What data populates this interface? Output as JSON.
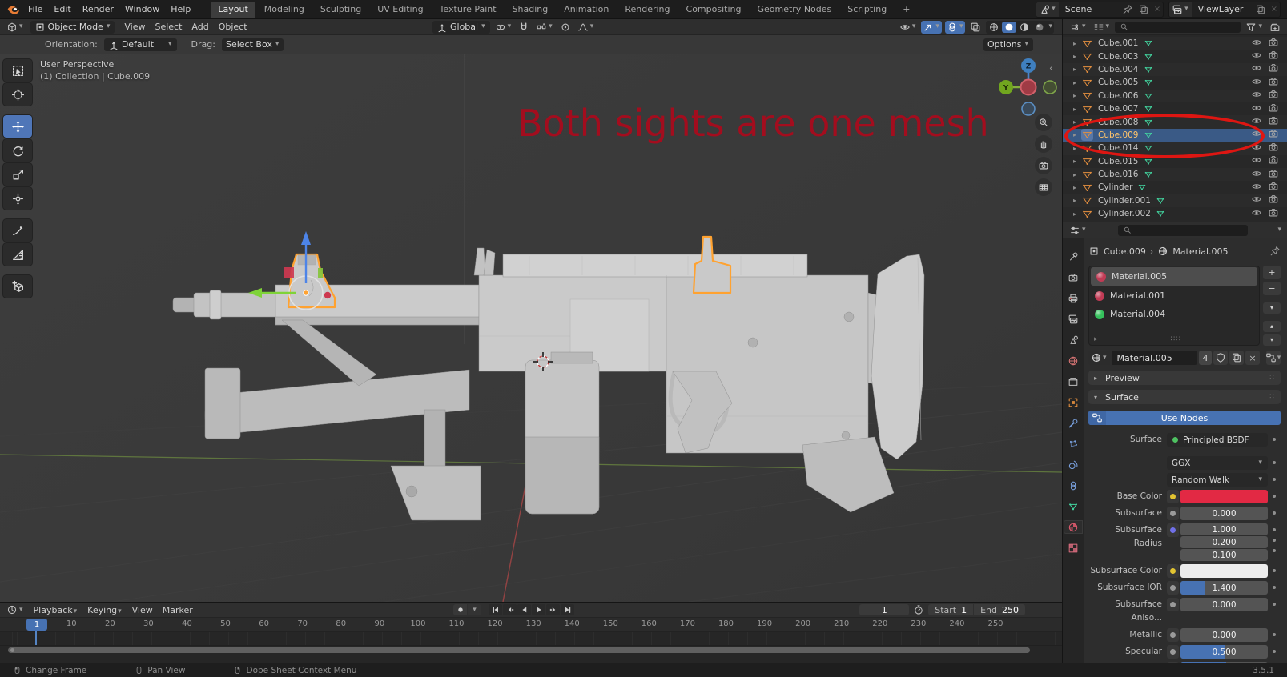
{
  "colors": {
    "accent_blue": "#4772b3",
    "selection_orange": "#ffa230",
    "annotation_red": "#a30d1e",
    "callout_red": "#de1612",
    "base_color_swatch": "#e22944"
  },
  "topbar": {
    "logo_icon": "blender-logo",
    "menus": [
      "File",
      "Edit",
      "Render",
      "Window",
      "Help"
    ],
    "workspaces": [
      "Layout",
      "Modeling",
      "Sculpting",
      "UV Editing",
      "Texture Paint",
      "Shading",
      "Animation",
      "Rendering",
      "Compositing",
      "Geometry Nodes",
      "Scripting"
    ],
    "active_workspace": "Layout",
    "add_workspace_label": "+",
    "scene_name": "Scene",
    "view_layer_name": "ViewLayer"
  },
  "viewport": {
    "header": {
      "editor_icon": "editor-3d",
      "mode_icon": "object-mode",
      "mode": "Object Mode",
      "menus": [
        "View",
        "Select",
        "Add",
        "Object"
      ],
      "orientation_value": "Global",
      "center_icons": [
        "transform-orientation",
        "pivot-point",
        "snap-magnet",
        "snap-target",
        "proportional-editing",
        "proportional-falloff"
      ],
      "right_icons": [
        "visibility",
        "gizmos",
        "overlays",
        "x-ray"
      ],
      "shading_icons": [
        "shading-wireframe",
        "shading-solid",
        "shading-material",
        "shading-rendered"
      ],
      "active_shading": "shading-solid"
    },
    "tool_settings": {
      "orientation_label": "Orientation:",
      "orientation_value": "Default",
      "drag_label": "Drag:",
      "drag_value": "Select Box",
      "options_label": "Options"
    },
    "overlay": {
      "line1": "User Perspective",
      "line2": "(1) Collection | Cube.009"
    },
    "annotation_text": "Both sights are one mesh",
    "tools": [
      "select-box",
      "cursor",
      "move",
      "rotate",
      "scale",
      "transform",
      "annotate",
      "measure",
      "add-cube"
    ],
    "active_tool": "move",
    "nav_gizmo_axes": [
      "Z",
      "Y"
    ],
    "nav_widgets": [
      "zoom",
      "pan-hand",
      "camera-view",
      "grid-ortho"
    ]
  },
  "outliner": {
    "header_icons": [
      "editor-outliner",
      "display-mode",
      "search",
      "filter",
      "new-collection"
    ],
    "items": [
      {
        "name": "Cube.001"
      },
      {
        "name": "Cube.003"
      },
      {
        "name": "Cube.004"
      },
      {
        "name": "Cube.005"
      },
      {
        "name": "Cube.006"
      },
      {
        "name": "Cube.007"
      },
      {
        "name": "Cube.008"
      },
      {
        "name": "Cube.009",
        "selected": true,
        "circled": true
      },
      {
        "name": "Cube.014"
      },
      {
        "name": "Cube.015"
      },
      {
        "name": "Cube.016"
      },
      {
        "name": "Cylinder"
      },
      {
        "name": "Cylinder.001"
      },
      {
        "name": "Cylinder.002"
      }
    ]
  },
  "properties": {
    "header_icons": [
      "editor-properties",
      "search"
    ],
    "tab_icons": [
      "tool",
      "render",
      "output",
      "view-layer",
      "scene",
      "world",
      "collection",
      "object",
      "modifiers",
      "particles",
      "physics",
      "constraints",
      "object-data",
      "material",
      "texture"
    ],
    "active_tab": "material",
    "breadcrumb": {
      "object": "Cube.009",
      "material": "Material.005"
    },
    "slots": [
      {
        "name": "Material.005",
        "color": "#c13b55",
        "selected": true
      },
      {
        "name": "Material.001",
        "color": "#c13b55",
        "selected": false
      },
      {
        "name": "Material.004",
        "color": "#35c15c",
        "selected": false
      }
    ],
    "datablock": {
      "name": "Material.005",
      "users": "4"
    },
    "panels": {
      "preview": "Preview",
      "surface": "Surface"
    },
    "use_nodes_label": "Use Nodes",
    "fields": [
      {
        "label": "Surface",
        "widget": "chip",
        "value": "Principled BSDF",
        "dot": "#4ec161"
      },
      {
        "label": "",
        "widget": "select",
        "value": "GGX",
        "gap_before": true
      },
      {
        "label": "",
        "widget": "select",
        "value": "Random Walk"
      },
      {
        "label": "Base Color",
        "widget": "color",
        "socket": "#e2c431",
        "value": "#e22944"
      },
      {
        "label": "Subsurface",
        "widget": "value",
        "socket": "#9a9a9a",
        "value": "0.000",
        "fill": 0
      },
      {
        "label": "Subsurface Radius",
        "widget": "vector",
        "socket": "#7070e8",
        "values": [
          "1.000",
          "0.200",
          "0.100"
        ]
      },
      {
        "label": "Subsurface Color",
        "widget": "color",
        "socket": "#e2c431",
        "value": "#ececec"
      },
      {
        "label": "Subsurface IOR",
        "widget": "value",
        "socket": "#9a9a9a",
        "value": "1.400",
        "fill": 0.28
      },
      {
        "label": "Subsurface Aniso...",
        "widget": "value",
        "socket": "#9a9a9a",
        "value": "0.000",
        "fill": 0
      },
      {
        "label": "Metallic",
        "widget": "value",
        "socket": "#9a9a9a",
        "value": "0.000",
        "fill": 0
      },
      {
        "label": "Specular",
        "widget": "value",
        "socket": "#9a9a9a",
        "value": "0.500",
        "fill": 0.5
      },
      {
        "label": "",
        "widget": "value",
        "socket": "#9a9a9a",
        "value": "",
        "fill": 0.52,
        "partial": true
      }
    ]
  },
  "timeline": {
    "editor_icon": "editor-timeline",
    "menus": [
      {
        "label": "Playback",
        "caret": true
      },
      {
        "label": "Keying",
        "caret": true
      },
      {
        "label": "View",
        "caret": false
      },
      {
        "label": "Marker",
        "caret": false
      }
    ],
    "transport": [
      "record",
      "jump-to-start",
      "previous-keyframe",
      "play-reverse",
      "play",
      "next-keyframe",
      "jump-to-end"
    ],
    "current_frame": "1",
    "start_label": "Start",
    "start_value": "1",
    "end_label": "End",
    "end_value": "250",
    "frame_start": 1,
    "frame_end": 250,
    "tick_frames": [
      10,
      20,
      30,
      40,
      50,
      60,
      70,
      80,
      90,
      100,
      110,
      120,
      130,
      140,
      150,
      160,
      170,
      180,
      190,
      200,
      210,
      220,
      230,
      240,
      250
    ]
  },
  "statusbar": {
    "hints": [
      {
        "icon": "mouse-left",
        "label": "Change Frame"
      },
      {
        "icon": "mouse-middle",
        "label": "Pan View"
      },
      {
        "icon": "mouse-right",
        "label": "Dope Sheet Context Menu"
      }
    ],
    "version": "3.5.1"
  }
}
